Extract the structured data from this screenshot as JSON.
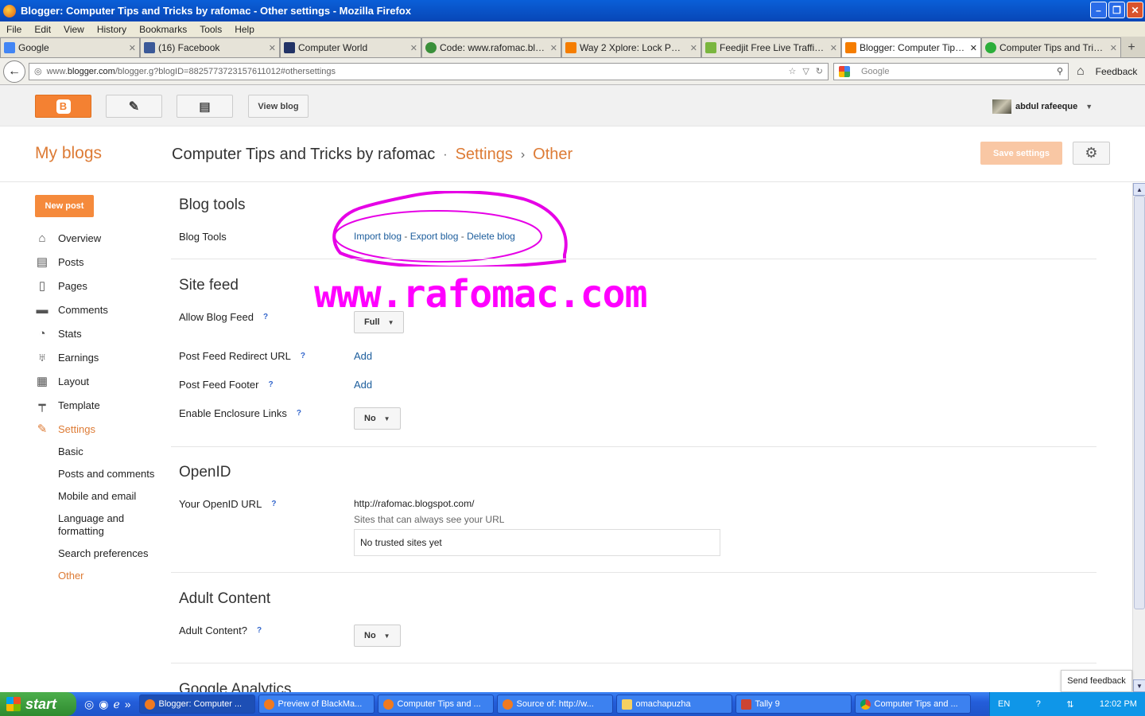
{
  "window": {
    "title": "Blogger: Computer Tips and Tricks by rafomac - Other settings - Mozilla Firefox"
  },
  "menu": [
    "File",
    "Edit",
    "View",
    "History",
    "Bookmarks",
    "Tools",
    "Help"
  ],
  "tabs": [
    {
      "label": "Google",
      "color": "#4285f4"
    },
    {
      "label": "(16) Facebook",
      "color": "#3b5998"
    },
    {
      "label": "Computer World",
      "color": "#223366"
    },
    {
      "label": "Code: www.rafomac.blog...",
      "color": "#3a8f3a"
    },
    {
      "label": "Way 2 Xplore: Lock PC Te...",
      "color": "#f57d00"
    },
    {
      "label": "Feedjit Free Live Traffic F...",
      "color": "#7ab63f"
    },
    {
      "label": "Blogger: Computer Tips a...",
      "color": "#f57d00"
    },
    {
      "label": "Computer Tips and Tricks ...",
      "color": "#2cae3a"
    }
  ],
  "address": {
    "prefix": "www.",
    "domain": "blogger.com",
    "path": "/blogger.g?blogID=8825773723157611012#othersettings"
  },
  "search": {
    "placeholder": "Google"
  },
  "feedback_label": "Feedback",
  "topbar": {
    "view_blog": "View blog",
    "user": "abdul rafeeque"
  },
  "header": {
    "my_blogs": "My blogs",
    "blog_title": "Computer Tips and Tricks by rafomac",
    "dot": "·",
    "settings": "Settings",
    "chev": "›",
    "other": "Other",
    "save": "Save settings"
  },
  "sidebar": {
    "new_post": "New post",
    "items": [
      {
        "label": "Overview",
        "icon": "⌂"
      },
      {
        "label": "Posts",
        "icon": "▤"
      },
      {
        "label": "Pages",
        "icon": "▯"
      },
      {
        "label": "Comments",
        "icon": "▬"
      },
      {
        "label": "Stats",
        "icon": "◔"
      },
      {
        "label": "Earnings",
        "icon": "♅"
      },
      {
        "label": "Layout",
        "icon": "▦"
      },
      {
        "label": "Template",
        "icon": "┯"
      },
      {
        "label": "Settings",
        "icon": "✎"
      }
    ],
    "sub": [
      "Basic",
      "Posts and comments",
      "Mobile and email",
      "Language and formatting",
      "Search preferences",
      "Other"
    ]
  },
  "content": {
    "blog_tools_title": "Blog tools",
    "blog_tools_label": "Blog Tools",
    "import": "Import blog",
    "export": "Export blog",
    "delete": "Delete blog",
    "dash": " - ",
    "watermark": "www.rafomac.com",
    "site_feed_title": "Site feed",
    "allow_feed": "Allow Blog Feed",
    "allow_feed_value": "Full",
    "redirect": "Post Feed Redirect URL",
    "add": "Add",
    "footer": "Post Feed Footer",
    "enclosure": "Enable Enclosure Links",
    "no": "No",
    "openid_title": "OpenID",
    "openid_label": "Your OpenID URL",
    "openid_url": "http://rafomac.blogspot.com/",
    "trusted_label": "Sites that can always see your URL",
    "trusted_value": "No trusted sites yet",
    "adult_title": "Adult Content",
    "adult_label": "Adult Content?",
    "ga_title": "Google Analytics",
    "q": "?"
  },
  "send_feedback": "Send feedback",
  "taskbar": {
    "start": "start",
    "items": [
      "Blogger: Computer ...",
      "Preview of BlackMa...",
      "Computer Tips and ...",
      "Source of: http://w...",
      "omachapuzha",
      "Tally 9",
      "Computer Tips and ..."
    ],
    "lang": "EN",
    "time": "12:02 PM"
  }
}
